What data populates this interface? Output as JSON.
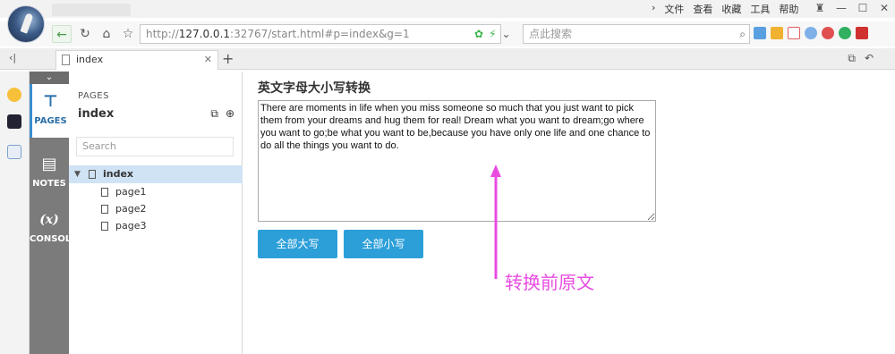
{
  "browser": {
    "menu": [
      "文件",
      "查看",
      "收藏",
      "工具",
      "帮助"
    ],
    "address": {
      "prefix": "http://",
      "host": "127.0.0.1",
      "rest": ":32767/start.html#p=index&g=1"
    },
    "search_placeholder": "点此搜索",
    "tab": {
      "label": "index"
    }
  },
  "sidebar": {
    "tools": [
      {
        "label": "PAGES",
        "icon": "sitemap-icon"
      },
      {
        "label": "NOTES",
        "icon": "notes-icon"
      },
      {
        "label": "CONSOLE",
        "icon": "variable-icon"
      }
    ],
    "console_glyph": "(x)",
    "panel_label": "PAGES",
    "panel_title": "index",
    "search_placeholder": "Search",
    "tree": [
      {
        "label": "index",
        "selected": true
      },
      {
        "label": "page1"
      },
      {
        "label": "page2"
      },
      {
        "label": "page3"
      }
    ]
  },
  "main": {
    "heading": "英文字母大小写转换",
    "textarea_value": "There are moments in life when you miss someone so much that you just want to pick them from your dreams and hug them for real! Dream what you want to dream;go where you want to go;be what you want to be,because you have only one life and one chance to do all the things you want to do.",
    "btn_upper": "全部大写",
    "btn_lower": "全部小写"
  },
  "annotation": {
    "text": "转换前原文",
    "color": "#e84ce0"
  },
  "colors": {
    "accent": "#2c9fd9",
    "sidebar_dark": "#7b7b7b",
    "selection": "#cfe3f5"
  }
}
